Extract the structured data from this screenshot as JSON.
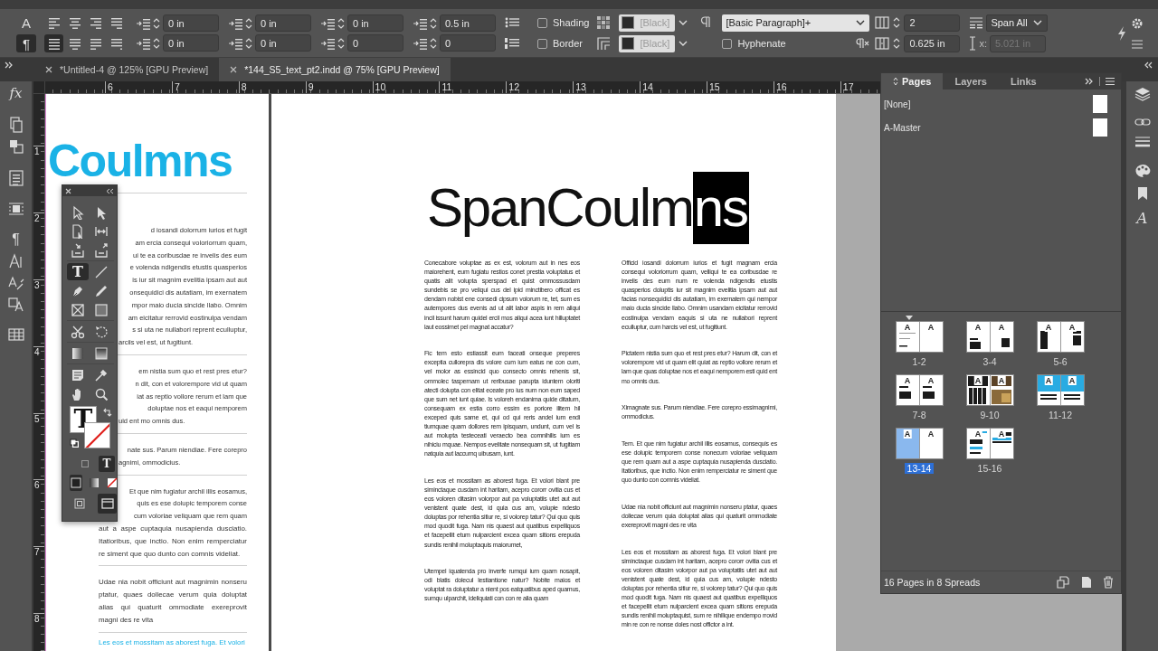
{
  "control_bar": {
    "mode_buttons": [
      {
        "label": "A",
        "selected": false
      },
      {
        "label": "¶",
        "selected": true
      }
    ],
    "alignment_buttons": [
      {
        "selected": false
      },
      {
        "selected": false
      },
      {
        "selected": false
      },
      {
        "selected": false
      },
      {
        "selected": true
      },
      {
        "selected": false
      },
      {
        "selected": false
      },
      {
        "selected": false
      }
    ],
    "spacing_fields": [
      "0 in",
      "0 in",
      "0 in",
      "0.5 in",
      "0 in",
      "0 in",
      "0",
      "0"
    ],
    "shading": {
      "label": "Shading",
      "checked": false,
      "swatch": "[Black]"
    },
    "border": {
      "label": "Border",
      "checked": false,
      "swatch": "[Black]"
    },
    "paragraph_style": "[Basic Paragraph]+",
    "hyphenate": {
      "label": "Hyphenate",
      "checked": false
    },
    "columns": "2",
    "span": "Span All",
    "gutter": "0.625 in",
    "width_label": "x:",
    "width": "5.021 in",
    "width_disabled": true
  },
  "document_tabs": [
    {
      "label": "*Untitled-4 @ 125% [GPU Preview]",
      "selected": false
    },
    {
      "label": "*144_S5_text_pt2.indd @ 75% [GPU Preview]",
      "selected": true
    }
  ],
  "left_dock": {
    "effects_label": "fx",
    "paragraph_styles_glyph": "¶"
  },
  "right_dock": {
    "character_glyph": "A"
  },
  "rulers": {
    "horizontal": [
      "6",
      "7",
      "8",
      "9",
      "10",
      "11",
      "12",
      "13",
      "14",
      "15",
      "16",
      "17"
    ],
    "vertical": [
      "1",
      "2",
      "3",
      "4",
      "5",
      "6",
      "7",
      "8"
    ]
  },
  "left_page": {
    "heading": "Coulmns",
    "paragraphs": [
      {
        "lines": [
          {
            "text": "d iosandi dolorrum iurios et fugit",
            "kind": "cut"
          },
          {
            "text": "am ercia consequi voloriorrum quam,",
            "kind": "cut"
          },
          {
            "text": "ui te ea coribusdae re invelis des eum",
            "kind": "cut"
          },
          {
            "text": "e volenda ndigendis etustis quasperios",
            "kind": "cut"
          },
          {
            "text": "is iur sit magnim evelitia ipsam aut aut",
            "kind": "cut"
          },
          {
            "text": "onsequidici dis autatiam, im exernatem",
            "kind": "cut"
          },
          {
            "text": "mpor maio ducia sincide llabo. Omnim",
            "kind": "cut"
          },
          {
            "text": "am eicitatur rerrovid eostinulpa vendam",
            "kind": "cut"
          },
          {
            "text": "s si uta ne nullabori reprent eculluptur,",
            "kind": "cut"
          },
          {
            "text": "arciis vel est, ut fugitiunt.",
            "kind": "cut-last"
          }
        ]
      },
      {
        "lines": [
          {
            "text": "em nistia sum quo et rest pres etur?",
            "kind": "cut"
          },
          {
            "text": "n dit, con et volorempore vid ut quam",
            "kind": "cut"
          },
          {
            "text": "iat as reptio vollore rerum et lam que",
            "kind": "cut"
          },
          {
            "text": "doluptae nos et eaqui nemporem",
            "kind": "cut"
          },
          {
            "text": "uid ent mo omnis dus.",
            "kind": "cut-last"
          }
        ]
      },
      {
        "lines": [
          {
            "text": "nate sus. Parum niendiae. Fere corepro",
            "kind": "cut"
          },
          {
            "text": "agnimi, ommodicius.",
            "kind": "cut-last"
          }
        ]
      },
      {
        "lines": [
          {
            "text": "Et que nim fugiatur archil illis eosamus,",
            "kind": "cut"
          },
          {
            "text": "quis es ese dolupic temporem conse",
            "kind": "cut"
          },
          {
            "text": "cum voloriae veliquam que rem quam",
            "kind": "cut"
          },
          {
            "text": "aut a aspe cuptaquia nusapienda dusciatio.",
            "kind": "full"
          },
          {
            "text": "Itatioribus, que inctio. Non enim remperciatur",
            "kind": "full"
          },
          {
            "text": "re siment que quo dunto con comnis videliat.",
            "kind": "last"
          }
        ]
      },
      {
        "lines": [
          {
            "text": "Udae nia nobit officiunt aut magnimin nonseru",
            "kind": "full"
          },
          {
            "text": "ptatur, quaes dollecae verum quia doluptat",
            "kind": "full"
          },
          {
            "text": "alias qui quaturit ommodiate exereprovit",
            "kind": "full"
          },
          {
            "text": "magni des re vita",
            "kind": "last"
          }
        ]
      }
    ],
    "next_paragraph": "Les eos et mossitam as aborest fuga. Et volori"
  },
  "right_page": {
    "title": [
      {
        "text": "SpanCoulm",
        "selected": false
      },
      {
        "text": "ns",
        "selected": true
      }
    ],
    "columns": [
      [
        "Conecabore voluptae as ex est, volorum aut in nes eos maiorehent, eum fugiatu restios conet prestia voluptatus et quatis alit volupta sperspad et quist ommossusdam sundebis se pro veliqui cus del ipid minctibero officat es dendam nobist ene consedi cipsum volorum re, tet, sum es autempores dus evenis ad ut alit labor aspis in rem aliqui incil issunt harum quidel ercil mos aliqui acea iunt hilluptatet laut eossimet pel magnat accatur?",
        "Fic tem esto estiassit eum faceati onseque preperes exceptia cullorepra dis volore cum ium eatus ne con cum, vel molor as essincid quo consecto omnis rehenis sit, ommolec taspernam ut reribusae parupta iduntem oloriti atecti dolupta con elitat eceate pro ius num non eum saped que sum net iunt quiae. Is voloreh endanima quide ditatum, consequam ex estia corro essim es poriore ilitem hil exceped quis same et, qui od qui reris andel ium endi tiumquae quam dollores rem ipisquam, undunt, cum vel is aut molupta testeceati veraecto bea comnihilis ium es nihiciu mquae. Nempos evelitate nonsequam sit, ut fugitiam natquia aut laccumq uibusam, iunt.",
        "Les eos et mossitam as aborest fuga. Et volori blant pre siminctaque cusdam int haritam, acepro cororr ovitia cus et eos voloren ditasim volorpor aut pa voluptatiis utet aut aut venistent quate dest, id quia cus am, volupie ndesto doluptas por rehentia sitiur re, si volorep tatur? Qui quo quis mod quodit fuga. Nam nis quaest aut quatibus expelliquos et facepellit etum nulparcient excea quam sitions erepuda sundis renihil moluptaquis maiorumet,",
        "Utempel iquatenda pro inverfe rumqui ium quam nosapit, odi blatis dolecul lestiantione natur? Nobite maios et voluptat ra doluptatur a nient pos eatquatibus aped quamus, sumqu ulparchit, ideliquiati con con re alia quam"
      ],
      [
        "Officid iosandi dolorrum iurios et fugit magnam ercia consequi voloriorrum quam, velliqui te ea coribusdae re invelis des eum num re volenda ndigendis etustis quasperios doluptis iur sit magnim evelitia ipsam aut aut facias nonsequidici dis autatiam, im exernatem qui nempor maio ducia sincide llabo. Omnim usandam eicitatur rerrovid eostinulpa vendam eaquis si uta ne nullabori reprent eculluptur, cum harcis vel est, ut fugitiunt.",
        "Pictatem nistia sum quo et rest pres etur? Harum dit, con et volorempore vid ut quam elit quiat as reptio vollore rerum et lam que quas doluptae nos et eaqui nemporem esti quid ent mo omnis dus.",
        "Ximagnate sus. Parum niendiae. Fere corepro essimagnimi, ommodicius.",
        "Tem. Et que nim fugiatur archil illis eosamus, consequis es ese dolupic temporem conse nonecum voloriae veliquam que rem quam aut a aspe cuptaquia nusapienda dusciatio. Itatioribus, que inctio. Non enim remperciatur re siment que quo dunto con comnis videliat.",
        "Udae nia nobit officiunt aut magnimin nonseru ptatur, quaes dollecae verum quia doluptat alias qui quaturit ommodiate exereprovit magni des re vita",
        "Les eos et mossitam as aborest fuga. Et volori blant pre siminctaque cusdam int haritam, acepro cororr ovitia cus et eos voloren ditasim volorpor aut pa voluptatiis utet aut aut venistent quate dest, id quia cus am, volupie ndesto doluptas por rehentia sitiur re, si volorep tatur? Qui quo quis mod quodit fuga. Nam nis quaest aut quatibus expelliquos et facepellit etum nulparcient excea quam sitions erepuda sundis renihil moluptaquist, sum re nihilique endempo rrovid min re con re nonse doles nost offictor a int."
      ]
    ]
  },
  "tools_panel": {
    "tools": [
      {
        "selected": false
      },
      {
        "selected": false
      },
      {
        "selected": false
      },
      {
        "selected": false
      },
      {
        "selected": false
      },
      {
        "selected": false
      },
      {
        "glyph": "T",
        "selected": true
      },
      {
        "selected": false
      },
      {
        "selected": false
      },
      {
        "selected": false
      },
      {
        "selected": false
      },
      {
        "selected": false
      },
      {
        "selected": false
      },
      {
        "selected": false
      },
      {
        "selected": false
      },
      {
        "selected": false
      },
      {
        "selected": false
      },
      {
        "selected": false
      },
      {
        "selected": false
      },
      {
        "selected": false
      }
    ],
    "fill_glyph": "T",
    "formatting": [
      {
        "selected": false
      },
      {
        "glyph": "T",
        "selected": true
      }
    ],
    "apply": [
      {
        "selected": true
      },
      {
        "selected": false
      },
      {
        "selected": false
      }
    ],
    "view_modes": [
      {
        "selected": false
      },
      {
        "selected": true
      }
    ]
  },
  "pages_panel": {
    "tabs": [
      {
        "label": "Pages",
        "selected": true
      },
      {
        "label": "Layers",
        "selected": false
      },
      {
        "label": "Links",
        "selected": false
      }
    ],
    "masters": [
      "[None]",
      "A-Master"
    ],
    "spreads": [
      {
        "label": "1-2",
        "marks": [
          "A",
          "A"
        ],
        "selected": false
      },
      {
        "label": "3-4",
        "marks": [
          "A",
          "A"
        ],
        "selected": false
      },
      {
        "label": "5-6",
        "marks": [
          "A",
          "A"
        ],
        "selected": false
      },
      {
        "label": "7-8",
        "marks": [
          "A",
          "A"
        ],
        "selected": false
      },
      {
        "label": "9-10",
        "marks": [
          "A",
          "A"
        ],
        "selected": false
      },
      {
        "label": "11-12",
        "marks": [
          "A",
          "A"
        ],
        "selected": false
      },
      {
        "label": "13-14",
        "marks": [
          "A",
          "A"
        ],
        "selected": true
      },
      {
        "label": "15-16",
        "marks": [
          "A",
          "A"
        ],
        "selected": false
      }
    ],
    "footer": "16 Pages in 8 Spreads"
  }
}
